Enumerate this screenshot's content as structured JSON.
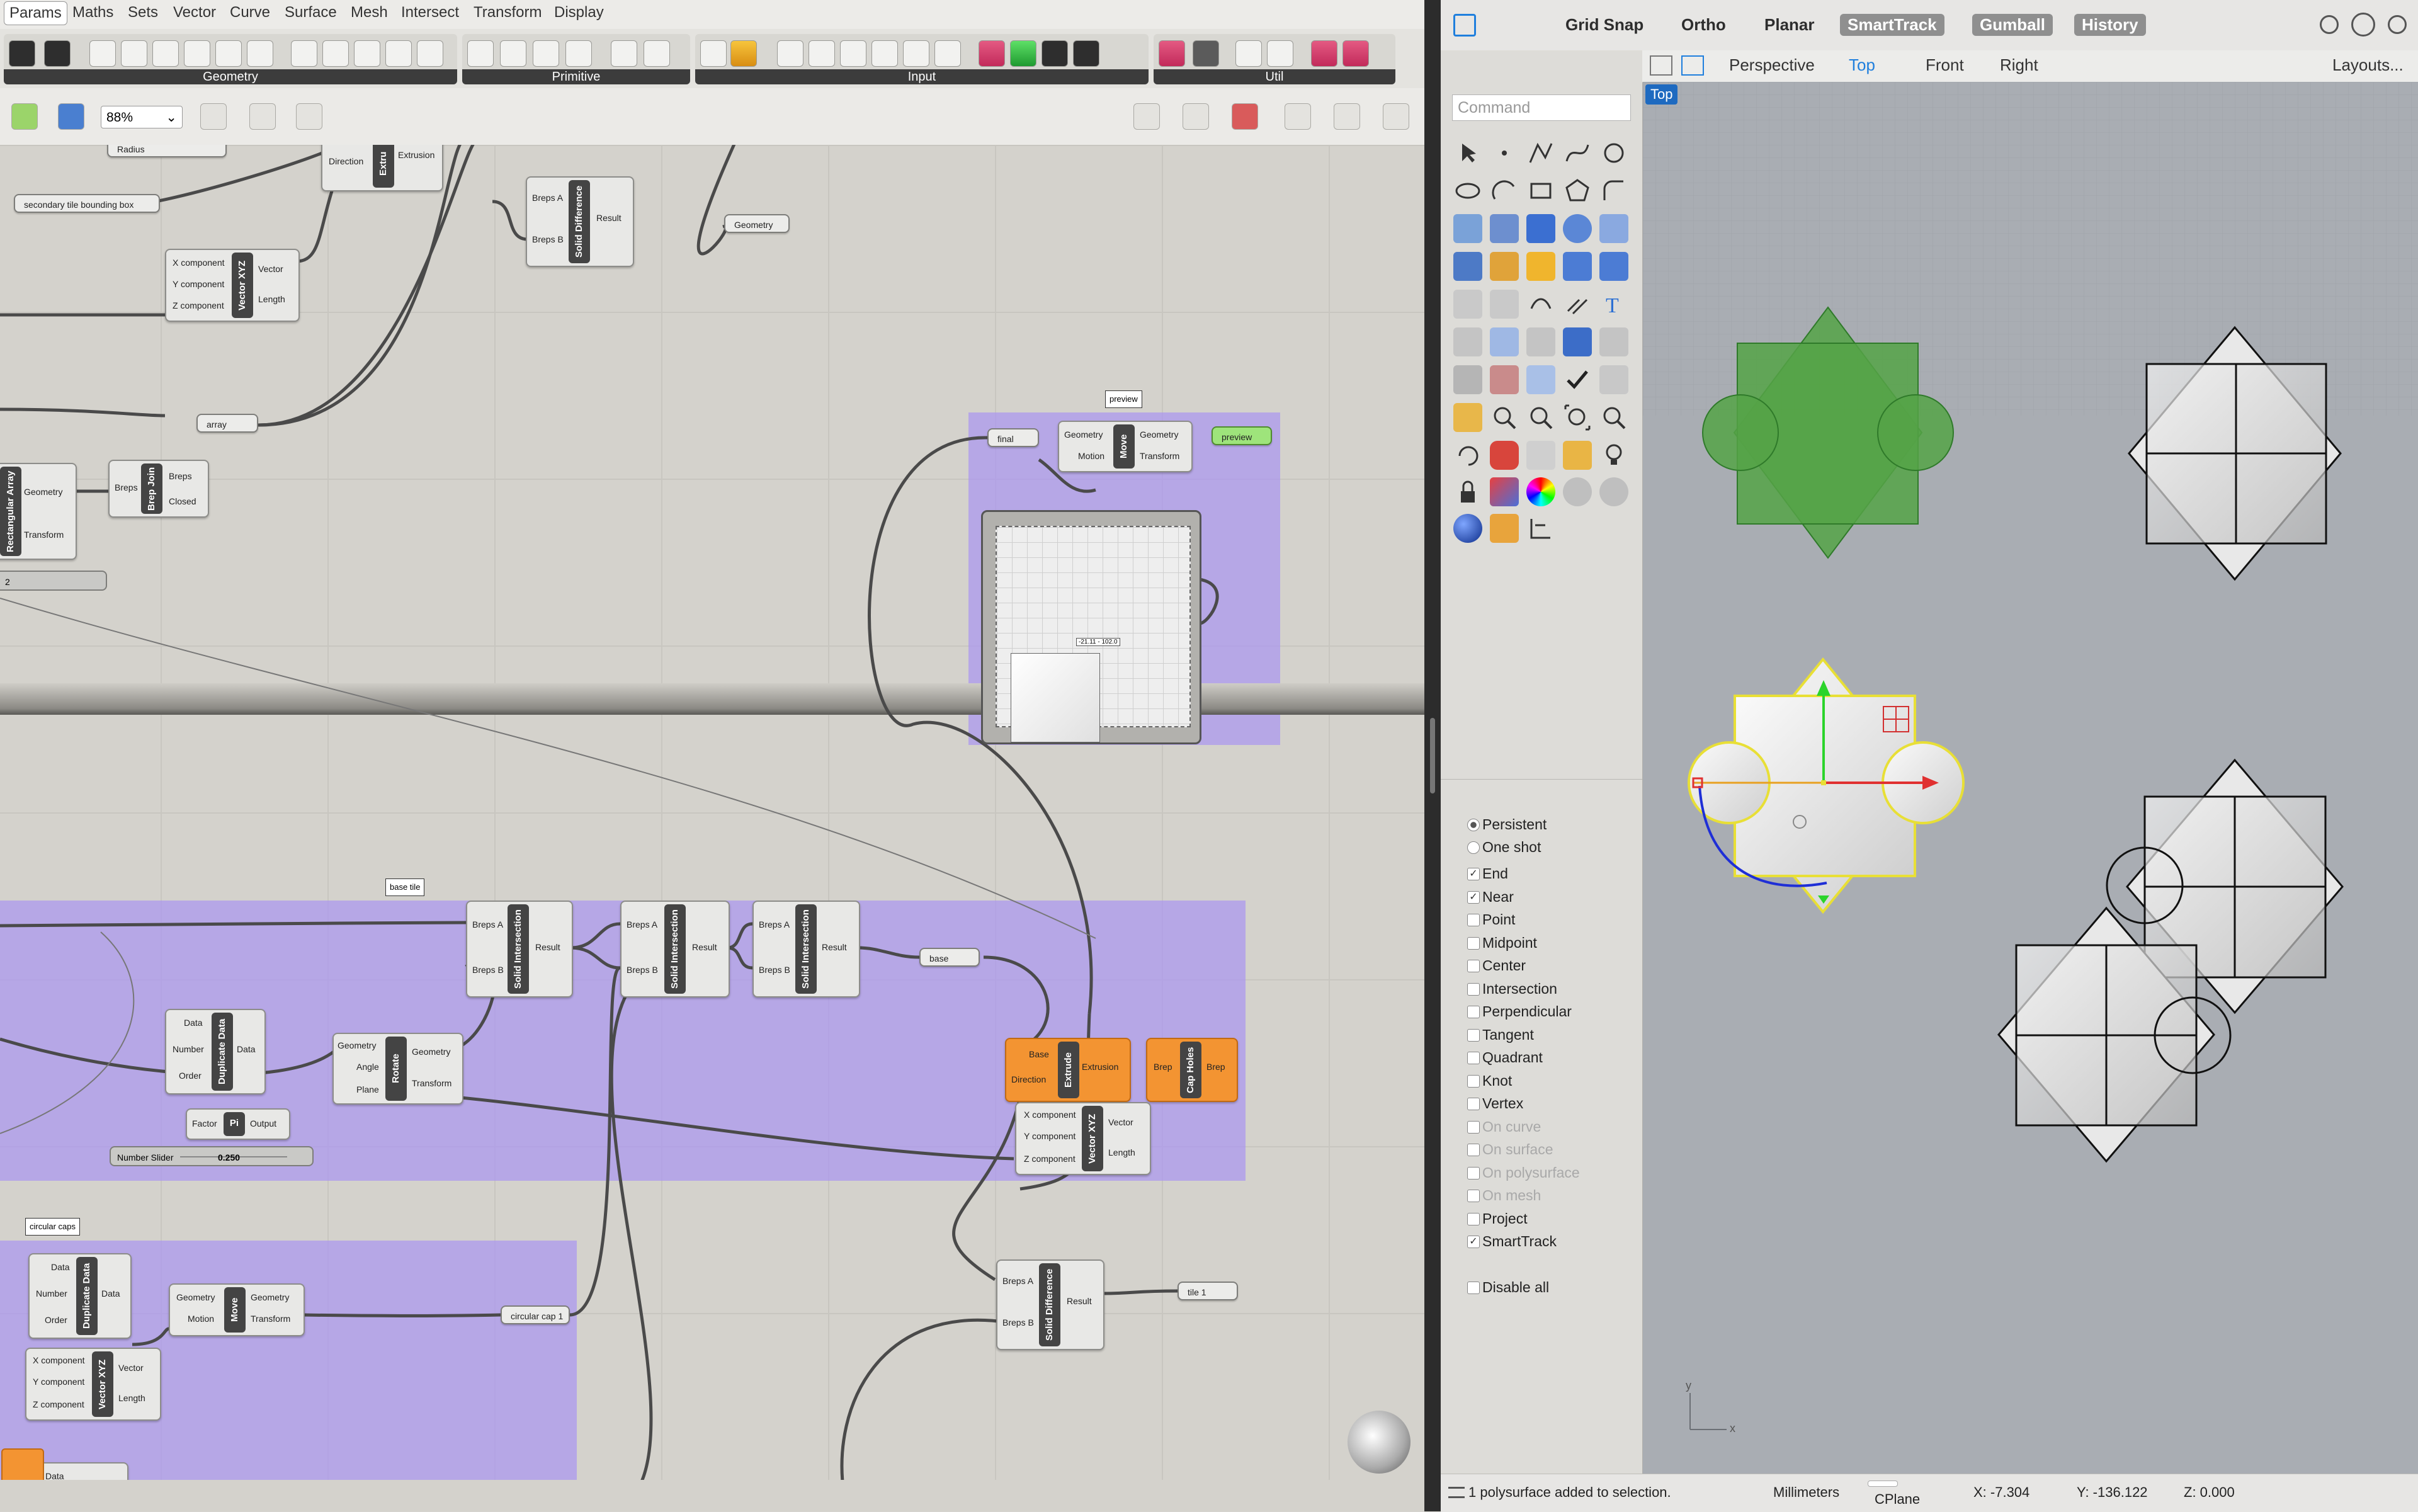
{
  "gh": {
    "menu": [
      "Params",
      "Maths",
      "Sets",
      "Vector",
      "Curve",
      "Surface",
      "Mesh",
      "Intersect",
      "Transform",
      "Display"
    ],
    "ribbon_panels": [
      "Geometry",
      "Primitive",
      "Input",
      "Util"
    ],
    "zoom": "88%",
    "groups": {
      "base_tile": "base tile",
      "circular_caps": "circular caps",
      "preview": "preview"
    },
    "params": {
      "radius": "Radius",
      "secondary": "secondary tile bounding box",
      "geometry": "Geometry",
      "array": "array",
      "final": "final",
      "preview": "preview",
      "base": "base",
      "circular_cap_1": "circular cap 1",
      "tile_1": "tile 1",
      "data": "Data"
    },
    "components": {
      "solid_difference": "Solid Difference",
      "vector_xyz": "Vector XYZ",
      "brep_join": "Brep Join",
      "rectangular_array": "Rectangular Array",
      "move": "Move",
      "solid_intersection": "Solid Intersection",
      "duplicate_data": "Duplicate Data",
      "rotate": "Rotate",
      "pi": "Pi",
      "extrude": "Extrude",
      "cap_holes": "Cap Holes"
    },
    "ports": {
      "breps_a": "Breps A",
      "breps_b": "Breps B",
      "result": "Result",
      "x": "X component",
      "y": "Y component",
      "z": "Z component",
      "vector": "Vector",
      "length": "Length",
      "breps": "Breps",
      "closed": "Closed",
      "geometry": "Geometry",
      "transform": "Transform",
      "motion": "Motion",
      "data": "Data",
      "number": "Number",
      "order": "Order",
      "angle": "Angle",
      "plane": "Plane",
      "factor": "Factor",
      "output": "Output",
      "base": "Base",
      "direction": "Direction",
      "extrusion": "Extrusion",
      "brep": "Brep"
    },
    "slider": {
      "name": "Number Slider",
      "value": "0.250"
    },
    "slider2_value": "2",
    "graph_tag": "-21.11 - 102.0",
    "extru_partial": "Extru"
  },
  "rhino": {
    "toolbar": [
      "Grid Snap",
      "Ortho",
      "Planar",
      "SmartTrack",
      "Gumball",
      "History"
    ],
    "toolbar_on": [
      "SmartTrack",
      "Gumball",
      "History"
    ],
    "views": [
      "Perspective",
      "Top",
      "Front",
      "Right"
    ],
    "active_view": "Top",
    "layouts": "Layouts...",
    "command_placeholder": "Command",
    "osnap_modes": [
      {
        "label": "Persistent",
        "type": "radio",
        "checked": true
      },
      {
        "label": "One shot",
        "type": "radio",
        "checked": false
      }
    ],
    "osnaps": [
      {
        "label": "End",
        "checked": true,
        "enabled": true
      },
      {
        "label": "Near",
        "checked": true,
        "enabled": true
      },
      {
        "label": "Point",
        "checked": false,
        "enabled": true
      },
      {
        "label": "Midpoint",
        "checked": false,
        "enabled": true
      },
      {
        "label": "Center",
        "checked": false,
        "enabled": true
      },
      {
        "label": "Intersection",
        "checked": false,
        "enabled": true
      },
      {
        "label": "Perpendicular",
        "checked": false,
        "enabled": true
      },
      {
        "label": "Tangent",
        "checked": false,
        "enabled": true
      },
      {
        "label": "Quadrant",
        "checked": false,
        "enabled": true
      },
      {
        "label": "Knot",
        "checked": false,
        "enabled": true
      },
      {
        "label": "Vertex",
        "checked": false,
        "enabled": true
      },
      {
        "label": "On curve",
        "checked": false,
        "enabled": false
      },
      {
        "label": "On surface",
        "checked": false,
        "enabled": false
      },
      {
        "label": "On polysurface",
        "checked": false,
        "enabled": false
      },
      {
        "label": "On mesh",
        "checked": false,
        "enabled": false
      },
      {
        "label": "Project",
        "checked": false,
        "enabled": true
      },
      {
        "label": "SmartTrack",
        "checked": true,
        "enabled": true
      }
    ],
    "disable_all": "Disable all",
    "status": {
      "message": "1 polysurface added to selection.",
      "units": "Millimeters",
      "cplane": "CPlane",
      "x": "X: -7.304",
      "y": "Y: -136.122",
      "z": "Z: 0.000"
    },
    "axis_x": "x",
    "axis_y": "y",
    "colors": {
      "selection": "#f0e64a",
      "gh_preview": "#5aa94a",
      "accent": "#1f7fdd"
    }
  }
}
